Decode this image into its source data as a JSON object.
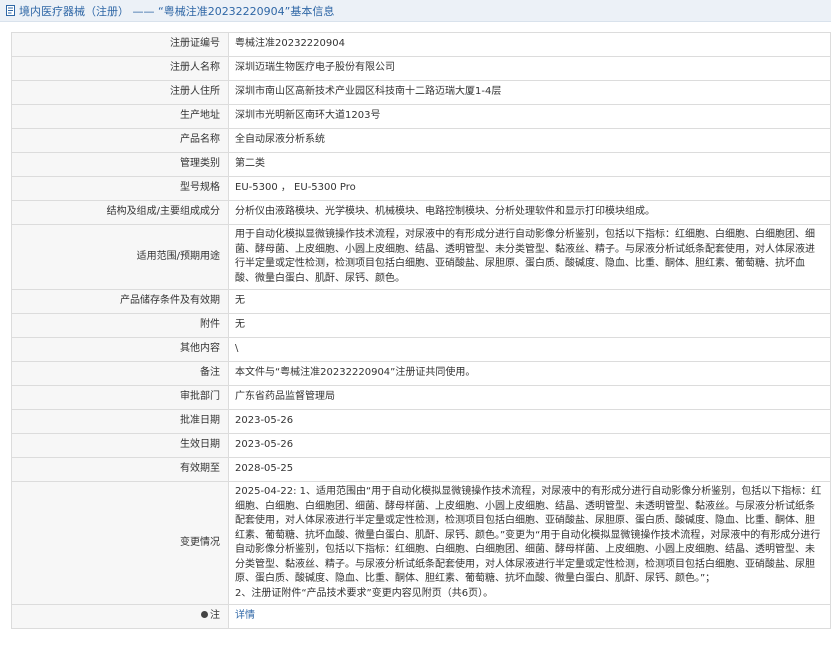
{
  "header": {
    "title": "境内医疗器械（注册） —— “粤械注准20232220904”基本信息",
    "icon": "document-icon",
    "colors": {
      "accent": "#2f67a6",
      "background": "#ecf1f7",
      "label_bg": "#f7f7f7",
      "border": "#dcdcdc"
    }
  },
  "rows": {
    "reg_no": {
      "label": "注册证编号",
      "value": "粤械注准20232220904"
    },
    "registrant_name": {
      "label": "注册人名称",
      "value": "深圳迈瑞生物医疗电子股份有限公司"
    },
    "registrant_address": {
      "label": "注册人住所",
      "value": "深圳市南山区高新技术产业园区科技南十二路迈瑞大厦1-4层"
    },
    "production_address": {
      "label": "生产地址",
      "value": "深圳市光明新区南环大道1203号"
    },
    "product_name": {
      "label": "产品名称",
      "value": "全自动尿液分析系统"
    },
    "category": {
      "label": "管理类别",
      "value": "第二类"
    },
    "model": {
      "label": "型号规格",
      "value": "EU-5300 ， EU-5300 Pro"
    },
    "structure": {
      "label": "结构及组成/主要组成成分",
      "value": "分析仪由液路模块、光学模块、机械模块、电路控制模块、分析处理软件和显示打印模块组成。"
    },
    "scope": {
      "label": "适用范围/预期用途",
      "value": "用于自动化模拟显微镜操作技术流程，对尿液中的有形成分进行自动影像分析鉴别，包括以下指标：红细胞、白细胞、白细胞团、细菌、酵母菌、上皮细胞、小圆上皮细胞、结晶、透明管型、未分类管型、黏液丝、精子。与尿液分析试纸条配套使用，对人体尿液进行半定量或定性检测，检测项目包括白细胞、亚硝酸盐、尿胆原、蛋白质、酸碱度、隐血、比重、酮体、胆红素、葡萄糖、抗坏血酸、微量白蛋白、肌酐、尿钙、颜色。"
    },
    "storage": {
      "label": "产品储存条件及有效期",
      "value": "无"
    },
    "attachment": {
      "label": "附件",
      "value": "无"
    },
    "other": {
      "label": "其他内容",
      "value": "\\"
    },
    "remark": {
      "label": "备注",
      "value": "本文件与“粤械注准20232220904”注册证共同使用。"
    },
    "department": {
      "label": "审批部门",
      "value": "广东省药品监督管理局"
    },
    "approval_date": {
      "label": "批准日期",
      "value": "2023-05-26"
    },
    "effective_date": {
      "label": "生效日期",
      "value": "2023-05-26"
    },
    "expiry_date": {
      "label": "有效期至",
      "value": "2028-05-25"
    },
    "changes": {
      "label": "变更情况",
      "line1": "2025-04-22: 1、适用范围由“用于自动化模拟显微镜操作技术流程，对尿液中的有形成分进行自动影像分析鉴别，包括以下指标：红细胞、白细胞、白细胞团、细菌、酵母样菌、上皮细胞、小圆上皮细胞、结晶、透明管型、未透明管型、黏液丝。与尿液分析试纸条配套使用，对人体尿液进行半定量或定性检测，检测项目包括白细胞、亚硝酸盐、尿胆原、蛋白质、酸碱度、隐血、比重、酮体、胆红素、葡萄糖、抗坏血酸、微量白蛋白、肌酐、尿钙、颜色。”变更为“用于自动化模拟显微镜操作技术流程，对尿液中的有形成分进行自动影像分析鉴别，包括以下指标：红细胞、白细胞、白细胞团、细菌、酵母样菌、上皮细胞、小圆上皮细胞、结晶、透明管型、未分类管型、黏液丝、精子。与尿液分析试纸条配套使用，对人体尿液进行半定量或定性检测，检测项目包括白细胞、亚硝酸盐、尿胆原、蛋白质、酸碱度、隐血、比重、酮体、胆红素、葡萄糖、抗坏血酸、微量白蛋白、肌酐、尿钙、颜色。”；",
      "line2": "2、注册证附件“产品技术要求”变更内容见附页（共6页）。"
    },
    "note": {
      "label": "注",
      "value": "详情",
      "icon": "bullet-icon"
    }
  }
}
